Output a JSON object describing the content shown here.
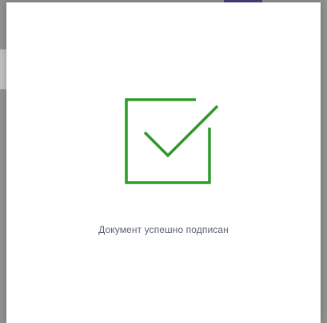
{
  "modal": {
    "message": "Документ успешно подписан"
  },
  "icons": {
    "success": "check-square-icon"
  },
  "colors": {
    "success": "#2e9a2a",
    "message_text": "#5a6472",
    "overlay": "#8f8f8f",
    "modal_bg": "#ffffff",
    "accent_bar": "#4b3d7a"
  }
}
